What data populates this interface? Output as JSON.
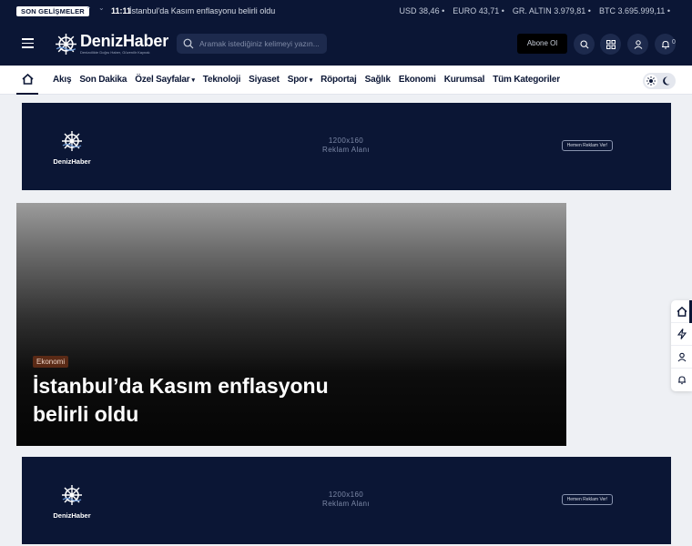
{
  "ticker": {
    "badge": "SON GELİŞMELER",
    "time": "11:11",
    "headline": "İstanbul'da Kasım enflasyonu belirli oldu",
    "rates": [
      "USD 38,46 •",
      "EURO 43,71 •",
      "GR. ALTIN 3.979,81 •",
      "BTC 3.695.999,11 •"
    ]
  },
  "header": {
    "logo_name": "DenizHaber",
    "logo_tagline": "Denizcilikte Doğru Haber, Güvenilir Kaynak",
    "search_placeholder": "Aramak istediğiniz kelimeyi yazın...",
    "subscribe_label": "Abone Ol",
    "notification_count": "0"
  },
  "nav": {
    "items": [
      "Akış",
      "Son Dakika",
      "Özel Sayfalar",
      "Teknoloji",
      "Siyaset",
      "Spor",
      "Röportaj",
      "Sağlık",
      "Ekonomi",
      "Kurumsal",
      "Tüm Kategoriler"
    ],
    "dropdown_caret": "▾"
  },
  "ad_top": {
    "logo_name": "DenizHaber",
    "size_line1": "1200x160",
    "size_line2": "Reklam Alanı",
    "cta": "Hemen Reklam Ver!"
  },
  "hero": {
    "category": "Ekonomi",
    "title": "İstanbul’da Kasım enflasyonu belirli oldu"
  },
  "ad_bottom": {
    "logo_name": "DenizHaber",
    "size_line1": "1200x160",
    "size_line2": "Reklam Alanı",
    "cta": "Hemen Reklam Ver!"
  },
  "colors": {
    "navy": "#0b1635",
    "navy_light": "#1d2a4d",
    "category_bg": "#5a2a16"
  },
  "icons": [
    "menu-icon",
    "search-icon",
    "grid-icon",
    "user-icon",
    "bell-icon",
    "home-icon",
    "sun-icon",
    "moon-icon",
    "bolt-icon"
  ]
}
